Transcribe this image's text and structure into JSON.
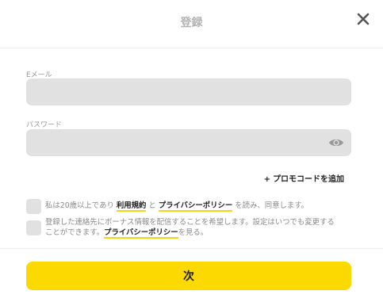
{
  "header": {
    "title": "登録",
    "close_icon": "close-icon"
  },
  "email": {
    "label": "Eメール",
    "value": "",
    "placeholder": ""
  },
  "password": {
    "label": "パスワード",
    "value": "",
    "placeholder": "",
    "toggle_icon": "eye-icon"
  },
  "promo": {
    "plus": "+",
    "label": "プロモコードを追加"
  },
  "consent_age": {
    "checked": false,
    "prefix": "私は20歳以上であり ",
    "terms_link": "利用規約",
    "middle": " と ",
    "privacy_link": "プライバシーポリシー",
    "suffix": " を読み、同意します。"
  },
  "consent_bonus": {
    "checked": false,
    "line1": "登録した連絡先にボーナス情報を配信することを希望します。設定はいつでも変更する",
    "line2_prefix": "ことができます。",
    "privacy_link": "プライバシーポリシー",
    "line2_suffix": "を見る。"
  },
  "next_button": {
    "label": "次"
  },
  "colors": {
    "accent": "#fcd900",
    "field_bg": "#e1e1e1",
    "muted_text": "#8a8a8a"
  }
}
